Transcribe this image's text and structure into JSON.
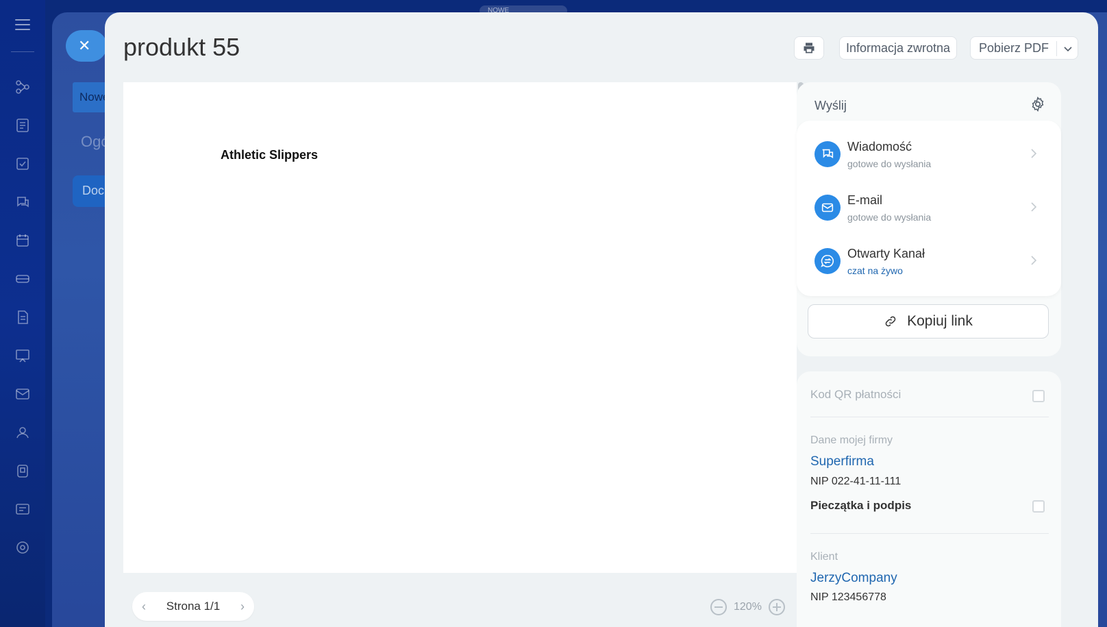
{
  "background": {
    "top_note": "NOWE",
    "chip1": "Nowe",
    "text1": "Ogó",
    "chip2": "Doc"
  },
  "rail": {
    "icons": [
      "flow-icon",
      "feed-icon",
      "tasks-icon",
      "chat-icon",
      "calendar-icon",
      "drive-icon",
      "docs-icon",
      "sites-icon",
      "mail-icon",
      "contacts-icon",
      "store-icon",
      "cards-icon",
      "goals-icon"
    ]
  },
  "document": {
    "title": "produkt 55",
    "print_label": "Drukuj",
    "feedback_label": "Informacja zwrotna",
    "pdf_label": "Pobierz PDF",
    "preview_heading": "Athletic Slippers",
    "page_label": "Strona 1/1",
    "zoom": "120%"
  },
  "send": {
    "label": "Wyślij",
    "items": [
      {
        "title": "Wiadomość",
        "subtitle": "gotowe do wysłania",
        "icon": "message-icon"
      },
      {
        "title": "E-mail",
        "subtitle": "gotowe do wysłania",
        "icon": "email-icon"
      },
      {
        "title": "Otwarty Kanał",
        "subtitle": "czat na żywo",
        "icon": "open-channel-icon"
      }
    ],
    "copy_link": "Kopiuj link"
  },
  "info": {
    "qr_label": "Kod QR płatności",
    "my_company_label": "Dane mojej firmy",
    "my_company": "Superfirma",
    "my_company_nip": "NIP 022-41-11-111",
    "stamp_label": "Pieczątka i podpis",
    "client_label": "Klient",
    "client": "JerzyCompany",
    "client_nip": "NIP 123456778"
  }
}
